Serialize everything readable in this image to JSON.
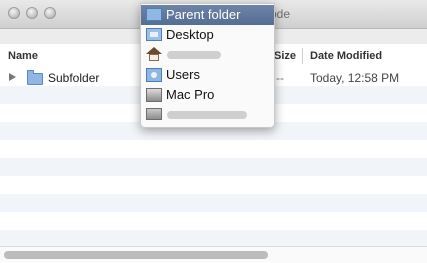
{
  "window": {
    "title_fragment": "ode"
  },
  "columns": {
    "name": "Name",
    "size": "Size",
    "date_modified": "Date Modified"
  },
  "rows": [
    {
      "name": "Subfolder",
      "size": "--",
      "date_modified": "Today, 12:58 PM"
    }
  ],
  "path_menu": {
    "items": [
      {
        "label": "Parent folder",
        "icon": "folder-icon",
        "selected": true
      },
      {
        "label": "Desktop",
        "icon": "desktop-folder-icon"
      },
      {
        "label": "",
        "icon": "home-icon",
        "obscured": true
      },
      {
        "label": "Users",
        "icon": "users-folder-icon"
      },
      {
        "label": "Mac Pro",
        "icon": "computer-icon"
      },
      {
        "label": "",
        "icon": "hard-disk-icon",
        "obscured": true
      }
    ]
  },
  "colors": {
    "selection": "#5f77a0",
    "folder_blue": "#8eb8e3",
    "stripe": "#f1f4f8"
  }
}
